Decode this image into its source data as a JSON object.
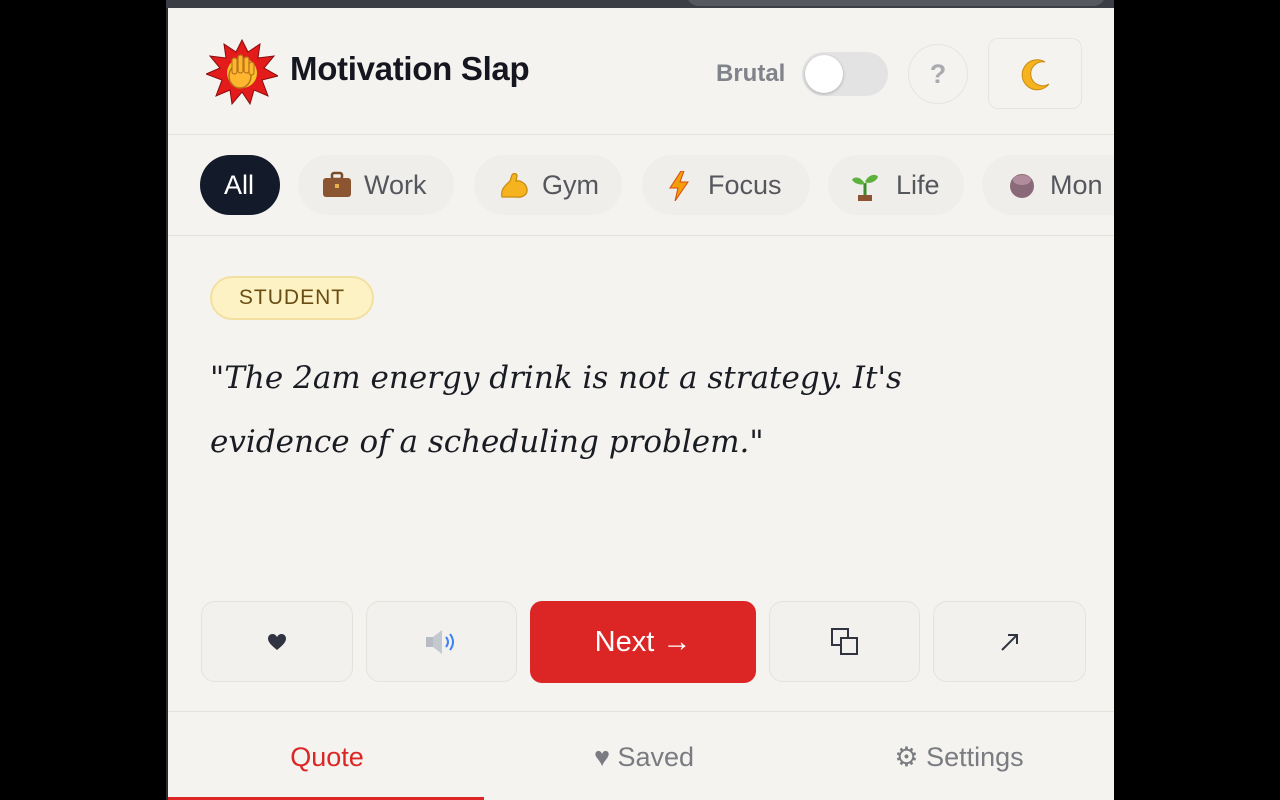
{
  "header": {
    "logo_icon": "waving-hand-burst-icon",
    "title": "Motivation Slap",
    "brutal_label": "Brutal",
    "brutal_enabled": false,
    "help_label": "?",
    "theme_icon": "crescent-moon-icon"
  },
  "categories": [
    {
      "label": "All",
      "icon": "",
      "active": true
    },
    {
      "label": "Work",
      "icon": "briefcase-icon",
      "active": false
    },
    {
      "label": "Gym",
      "icon": "flexed-biceps-icon",
      "active": false
    },
    {
      "label": "Focus",
      "icon": "lightning-icon",
      "active": false
    },
    {
      "label": "Life",
      "icon": "seedling-icon",
      "active": false
    },
    {
      "label": "Mon",
      "icon": "money-icon",
      "active": false
    }
  ],
  "quote": {
    "tag": "STUDENT",
    "text": "\"The 2am energy drink is not a strategy. It's evidence of a scheduling problem.\""
  },
  "actions": {
    "favorite_icon": "heart-icon",
    "speak_icon": "speaker-icon",
    "next_label": "Next →",
    "copy_icon": "copy-icon",
    "share_icon": "share-arrow-icon"
  },
  "nav": {
    "tabs": [
      {
        "label": "Quote",
        "active": true
      },
      {
        "label": "♥ Saved",
        "active": false
      },
      {
        "label": "⚙ Settings",
        "active": false
      }
    ]
  },
  "colors": {
    "accent": "#dc2626",
    "background": "#f4f3ef",
    "chip_active": "#131a2a",
    "tag_bg": "#fdf2c4"
  }
}
